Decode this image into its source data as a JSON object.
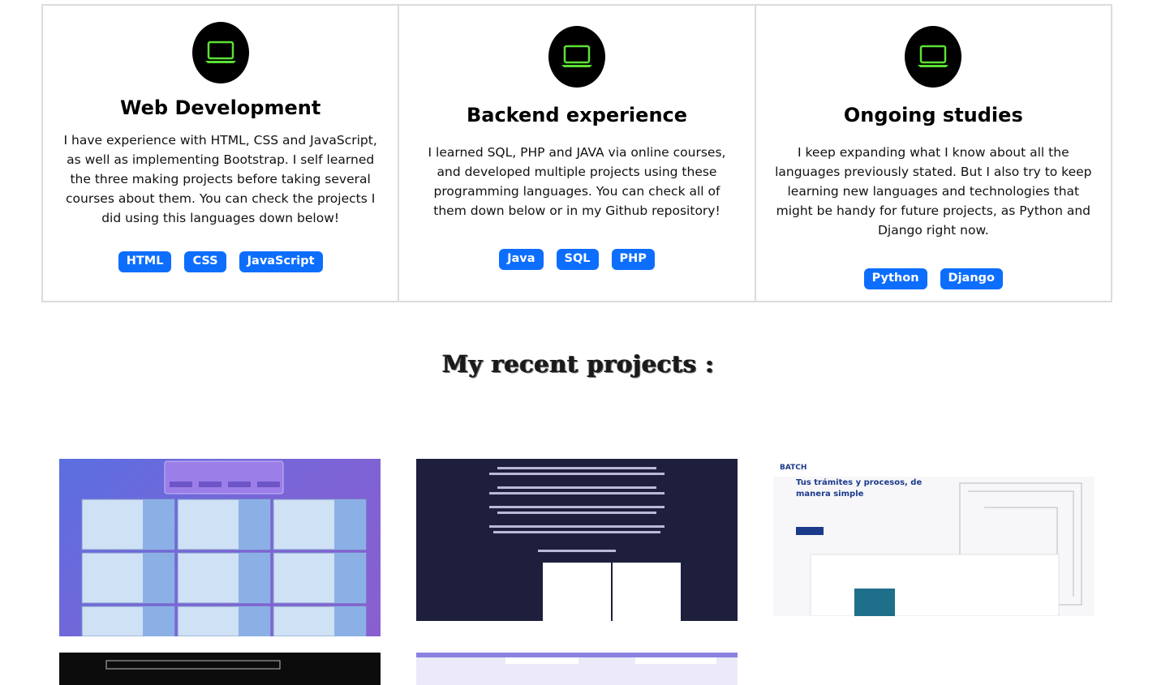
{
  "cards": [
    {
      "title": "Web Development",
      "text": "I have experience with HTML, CSS and JavaScript, as well as implementing Bootstrap. I self learned the three making projects before taking several courses about them. You can check the projects I did using this languages down below!",
      "badges": [
        "HTML",
        "CSS",
        "JavaScript"
      ],
      "icon": "laptop-icon"
    },
    {
      "title": "Backend experience",
      "text": "I learned SQL, PHP and JAVA via online courses, and developed multiple projects using these programming languages. You can check all of them down below or in my Github repository!",
      "badges": [
        "Java",
        "SQL",
        "PHP"
      ],
      "icon": "laptop-icon"
    },
    {
      "title": "Ongoing studies",
      "text": "I keep expanding what I know about all the languages previously stated. But I also try to keep learning new languages and technologies that might be handy for future projects, as Python and Django right now.",
      "badges": [
        "Python",
        "Django"
      ],
      "icon": "laptop-icon"
    }
  ],
  "projects": {
    "title": "My recent projects :"
  },
  "colors": {
    "badge": "#0d6efd",
    "icon_bg": "#000000",
    "icon_fg": "#5ce035",
    "border": "#dcdcdc"
  }
}
